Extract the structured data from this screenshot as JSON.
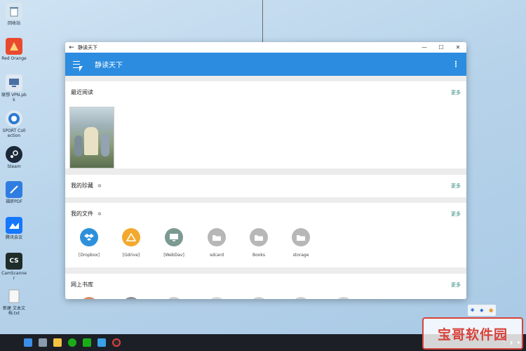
{
  "desktop": {
    "icons": [
      {
        "label": "回收站",
        "icon": "recycle-bin-icon",
        "color": "#d8e6f0"
      },
      {
        "label": "Red Orange",
        "icon": "red-orange-icon",
        "color": "#e94a2e"
      },
      {
        "label": "联想 VPN.pbk",
        "icon": "vpn-icon",
        "color": "#4a6fa5"
      },
      {
        "label": "SPORT Collection",
        "icon": "sport-icon",
        "color": "#2a7bd4"
      },
      {
        "label": "Steam",
        "icon": "steam-icon",
        "color": "#1b2838"
      },
      {
        "label": "福昕PDF",
        "icon": "pdf-icon",
        "color": "#2f7de1"
      },
      {
        "label": "腾讯会议",
        "icon": "meeting-icon",
        "color": "#1677ff"
      },
      {
        "label": "CamScanner",
        "icon": "camscanner-icon",
        "color": "#1f2d2a"
      },
      {
        "label": "新建 文本文档.txt",
        "icon": "text-file-icon",
        "color": "#f4f4f4"
      }
    ]
  },
  "window": {
    "titlebar_title": "静读天下",
    "back_glyph": "←",
    "minimize_glyph": "—",
    "maximize_glyph": "☐",
    "close_glyph": "✕",
    "appbar_title": "静读天下",
    "more_glyph": "⋮"
  },
  "sections": {
    "recent": {
      "title": "最近阅读",
      "more": "更多"
    },
    "favorites": {
      "title": "我的珍藏",
      "more": "更多"
    },
    "files": {
      "title": "我的文件",
      "more": "更多",
      "items": [
        {
          "label": "[Dropbox]",
          "icon": "dropbox-icon",
          "color": "#2e90db"
        },
        {
          "label": "[Gdrive]",
          "icon": "gdrive-icon",
          "color": "#f2a92d"
        },
        {
          "label": "[WebDav]",
          "icon": "webdav-icon",
          "color": "#7a9a92"
        },
        {
          "label": "sdcard",
          "icon": "folder-icon",
          "color": "#b7b7b7"
        },
        {
          "label": "Books",
          "icon": "folder-icon",
          "color": "#b7b7b7"
        },
        {
          "label": "storage",
          "icon": "folder-icon",
          "color": "#b7b7b7"
        }
      ]
    },
    "online": {
      "title": "网上书库",
      "more": "更多"
    }
  },
  "watermark": "宝哥软件园",
  "colors": {
    "accent": "#2b8ce0",
    "more_link": "#2f8c7d"
  }
}
